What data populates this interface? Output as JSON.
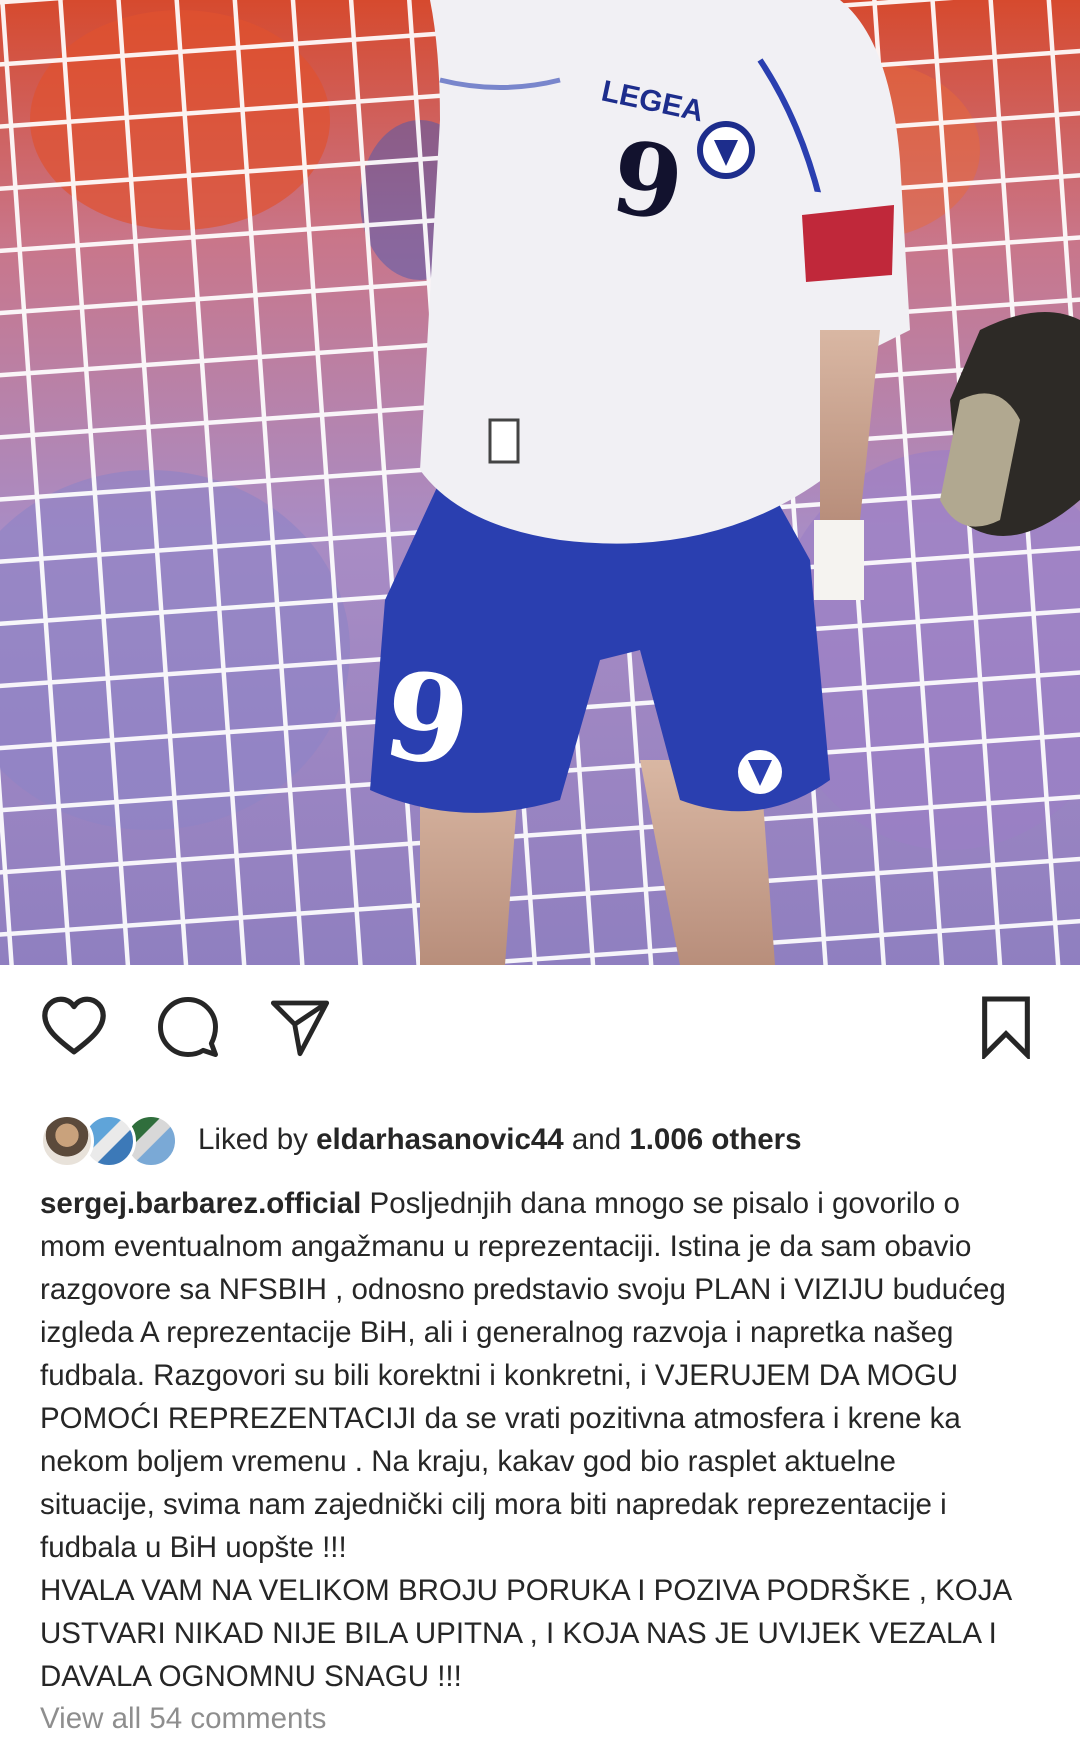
{
  "post": {
    "image_alt": "Football player in white shirt number 9 and blue shorts in front of a goal net"
  },
  "actions": {
    "like_icon": "heart-icon",
    "comment_icon": "comment-icon",
    "share_icon": "paper-plane-icon",
    "save_icon": "bookmark-icon"
  },
  "likes": {
    "prefix": "Liked by ",
    "user": "eldarhasanovic44",
    "middle": " and ",
    "count": "1.006 others"
  },
  "caption": {
    "username": "sergej.barbarez.official",
    "lines": [
      " Posljednjih dana mnogo se pisalo i govorilo o",
      "mom eventualnom angažmanu u reprezentaciji. Istina je da sam obavio",
      "razgovore sa NFSBIH , odnosno predstavio svoju PLAN i VIZIJU budućeg",
      "izgleda A reprezentacije BiH, ali i generalnog razvoja i napretka našeg",
      "fudbala. Razgovori su bili korektni i konkretni, i VJERUJEM DA MOGU",
      "POMOĆI REPREZENTACIJI da se vrati pozitivna atmosfera i krene ka",
      "nekom boljem vremenu .  Na kraju, kakav god bio rasplet aktuelne",
      "situacije, svima nam zajednički cilj mora biti napredak reprezentacije i",
      "fudbala u BiH uopšte !!!",
      "HVALA VAM NA VELIKOM BROJU PORUKA I POZIVA PODRŠKE , KOJA",
      "USTVARI NIKAD NIJE BILA UPITNA , I KOJA NAS JE UVIJEK VEZALA I",
      "DAVALA OGNOMNU SNAGU !!!"
    ]
  },
  "comments": {
    "view_all": "View all 54 comments"
  },
  "colors": {
    "text": "#262626",
    "muted": "#8e8e8e",
    "shirt": "#f1f0f4",
    "shorts": "#2a3fb0",
    "armband": "#c0283a"
  }
}
